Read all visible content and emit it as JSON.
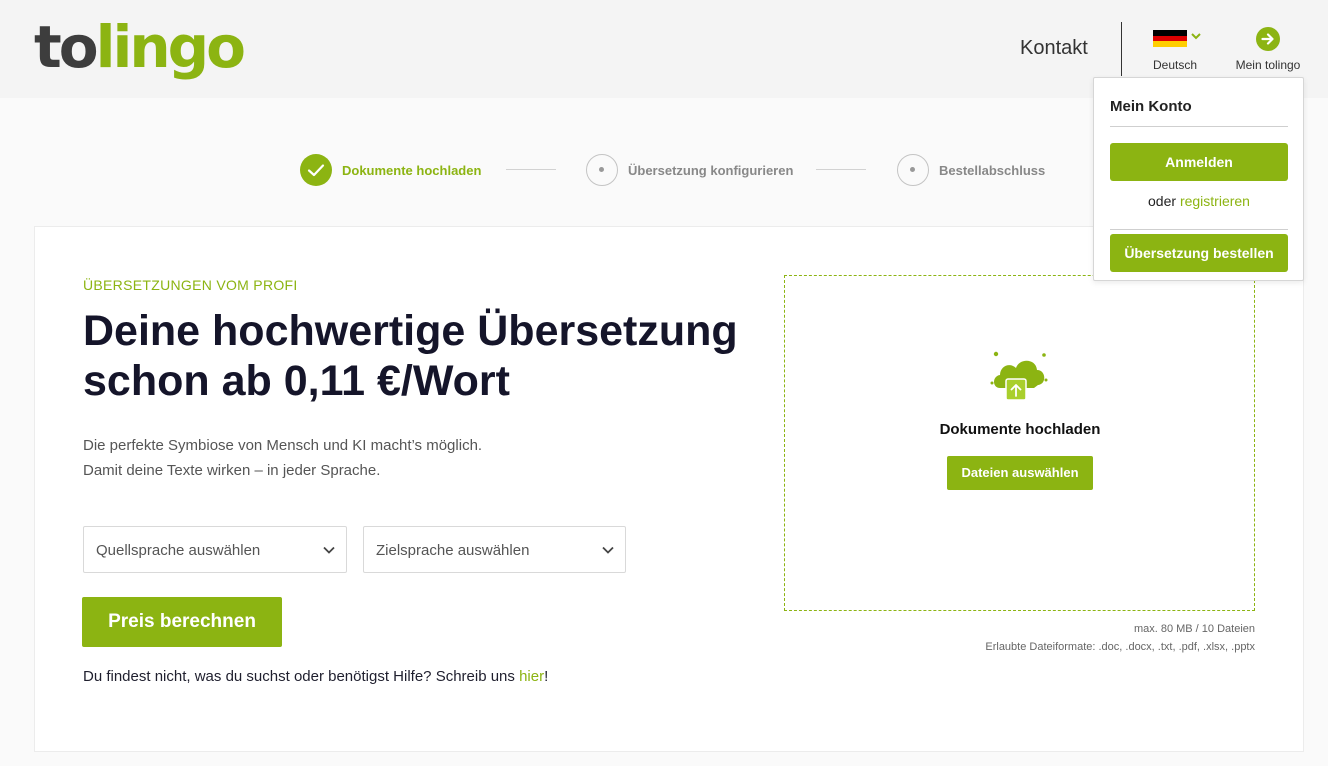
{
  "header": {
    "logo_part1": "to",
    "logo_part2": "lingo",
    "kontakt": "Kontakt",
    "language_label": "Deutsch",
    "account_label": "Mein tolingo"
  },
  "steps": [
    {
      "label": "Dokumente hochladen",
      "state": "done"
    },
    {
      "label": "Übersetzung konfigurieren",
      "state": "open"
    },
    {
      "label": "Bestellabschluss",
      "state": "open"
    }
  ],
  "hero": {
    "eyebrow": "ÜBERSETZUNGEN VOM PROFI",
    "headline_line1": "Deine hochwertige Übersetzung",
    "headline_line2": "schon ab 0,11 €/Wort",
    "sub_line1": "Die perfekte Symbiose von Mensch und KI macht’s möglich.",
    "sub_line2": "Damit deine Texte wirken – in jeder Sprache."
  },
  "form": {
    "source_placeholder": "Quellsprache auswählen",
    "target_placeholder": "Zielsprache auswählen",
    "submit_label": "Preis berechnen",
    "help_text": "Du findest nicht, was du suchst oder benötigst Hilfe? Schreib uns ",
    "help_link": "hier",
    "help_suffix": "!"
  },
  "upload": {
    "title": "Dokumente hochladen",
    "button_label": "Dateien auswählen",
    "limit_note": "max. 80 MB / 10 Dateien",
    "formats_note": "Erlaubte Dateiformate: .doc, .docx, .txt, .pdf, .xlsx, .pptx"
  },
  "account_menu": {
    "title": "Mein Konto",
    "login_label": "Anmelden",
    "or_text": "oder ",
    "register_link": "registrieren",
    "order_label": "Übersetzung bestellen"
  },
  "colors": {
    "accent": "#8cb412",
    "text_dark": "#15152a",
    "flag": [
      "#000000",
      "#dd0000",
      "#ffce00"
    ]
  },
  "icons": [
    "check-icon",
    "chevron-down-icon",
    "arrow-right-circle-icon",
    "cloud-upload-icon"
  ]
}
